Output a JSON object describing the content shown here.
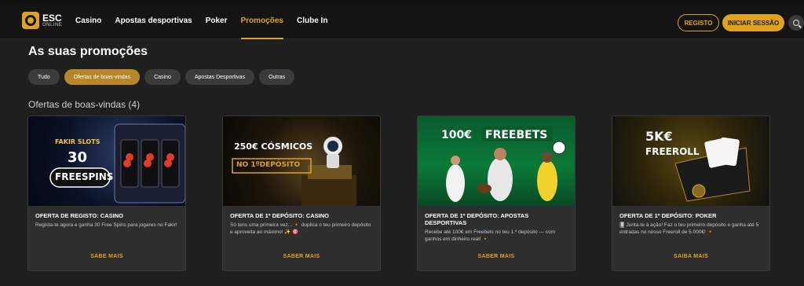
{
  "header": {
    "logo": {
      "name": "ESC",
      "sub": "ONLINE"
    },
    "nav": [
      {
        "label": "Casino",
        "active": false
      },
      {
        "label": "Apostas desportivas",
        "active": false
      },
      {
        "label": "Poker",
        "active": false
      },
      {
        "label": "Promoções",
        "active": true
      },
      {
        "label": "Clube In",
        "active": false
      }
    ],
    "register_label": "REGISTO",
    "login_label": "INICIAR SESSÃO"
  },
  "main": {
    "title": "As suas promoções",
    "filters": [
      {
        "label": "Tudo",
        "active": false
      },
      {
        "label": "Ofertas de boas-vindas",
        "active": true
      },
      {
        "label": "Casino",
        "active": false
      },
      {
        "label": "Apostas Desportivas",
        "active": false
      },
      {
        "label": "Outras",
        "active": false
      }
    ],
    "section_title": "Ofertas de boas-vindas (4)",
    "cards": [
      {
        "title": "OFERTA DE REGISTO: CASINO",
        "desc": "Regista-te agora e ganha 30 Free Spins para jogares no Fakir!",
        "cta": "SABE MAIS",
        "img_line1": "FAKIR SLOTS",
        "img_line2": "30",
        "img_line3": "FREESPINS"
      },
      {
        "title": "OFERTA DE 1º DEPÓSITO: CASINO",
        "desc": "Só tens uma primeira vez... 🔸 duplica o teu primeiro depósito e aproveita ao máximo! ✨ 🎯",
        "cta": "SABER MAIS",
        "img_line1": "250€ CÓSMICOS",
        "img_line2": "NO 1ºDEPÓSITO"
      },
      {
        "title": "OFERTA DE 1º DEPÓSITO: APOSTAS DESPORTIVAS",
        "desc": "Recebe até 100€ em Freebets no teu 1.º depósito — com ganhos em dinheiro real! 🔸",
        "cta": "SABER MAIS",
        "img_line1": "100€",
        "img_line2": "FREEBETS"
      },
      {
        "title": "OFERTA DE 1º DEPÓSITO: POKER",
        "desc": "🂠 Junta-te à ação! Faz o teu primeiro depósito e ganha até 5 entradas no nosso Freeroll de 5.000€! 🔸",
        "cta": "SAIBA MAIS",
        "img_line1": "5K€",
        "img_line2": "FREEROLL"
      }
    ]
  },
  "colors": {
    "accent": "#e0a31f",
    "background": "#1f1f1f",
    "card": "#2e2e2e"
  }
}
